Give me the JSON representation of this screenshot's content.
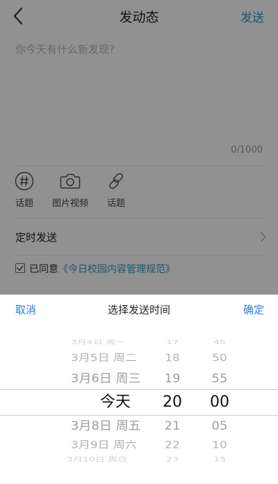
{
  "nav": {
    "title": "发动态",
    "send_label": "发送"
  },
  "compose": {
    "placeholder": "你今天有什么新发现？",
    "counter": "0/1000"
  },
  "tools": [
    {
      "label": "话题",
      "icon": "hashtag-icon"
    },
    {
      "label": "图片视频",
      "icon": "camera-icon"
    },
    {
      "label": "话题",
      "icon": "link-icon"
    }
  ],
  "timed_post": {
    "label": "定时发送"
  },
  "agreement": {
    "prefix": "已同意",
    "link": "《今日校园内容管理规范》",
    "checked": true
  },
  "picker": {
    "cancel_label": "取消",
    "title": "选择发送时间",
    "confirm_label": "确定",
    "dates": [
      "3月4日 周一",
      "3月5日 周二",
      "3月6日 周三",
      "今天",
      "3月8日 周五",
      "3月9日 周六",
      "3月10日 周日"
    ],
    "hours": [
      "17",
      "18",
      "19",
      "20",
      "21",
      "22",
      "23"
    ],
    "minutes": [
      "45",
      "50",
      "55",
      "00",
      "05",
      "10",
      "15"
    ],
    "selected": {
      "date": "今天",
      "hour": "20",
      "minute": "00"
    }
  },
  "colors": {
    "accent": "#2a9bd1",
    "picker_accent": "#2a7fd6",
    "overlay": "rgba(0,0,0,0.43)"
  }
}
